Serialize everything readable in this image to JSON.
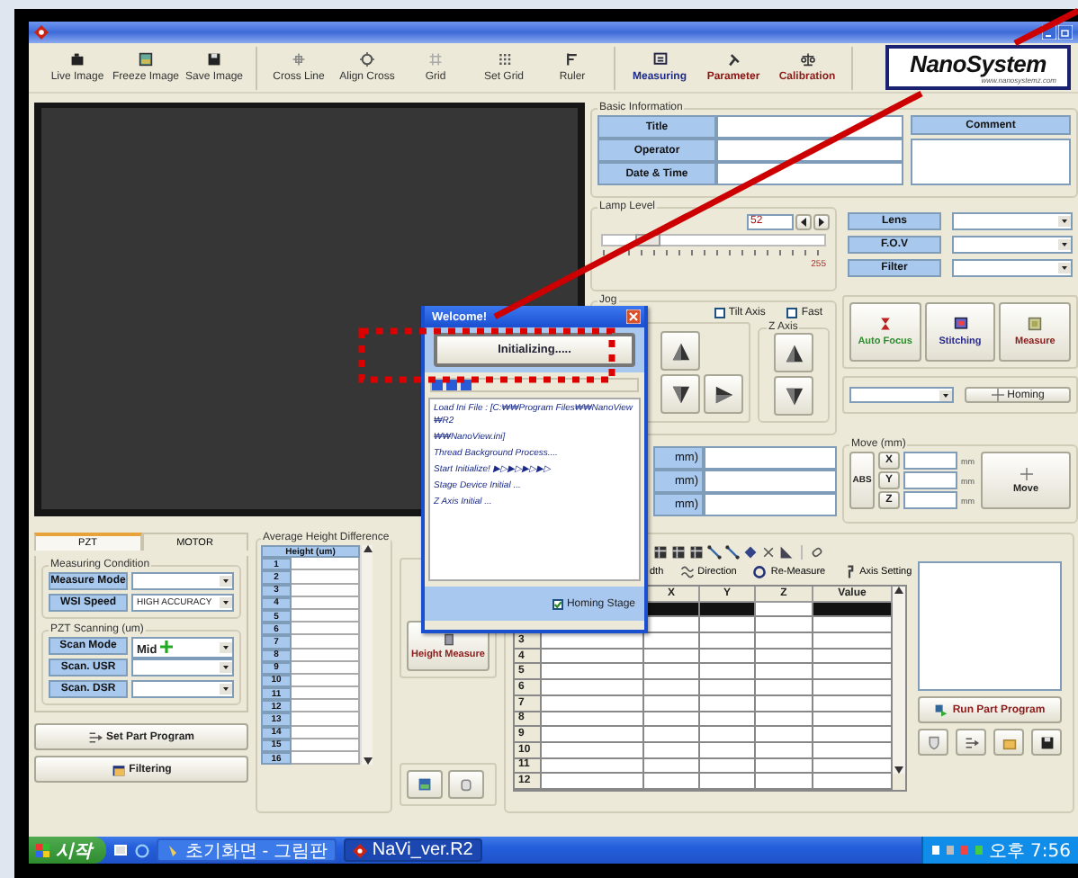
{
  "toolbar": {
    "items": [
      {
        "label": "Live Image",
        "color": "#333333"
      },
      {
        "label": "Freeze Image",
        "color": "#333333"
      },
      {
        "label": "Save Image",
        "color": "#333333"
      },
      {
        "label": "Cross Line",
        "color": "#333333"
      },
      {
        "label": "Align Cross",
        "color": "#333333"
      },
      {
        "label": "Grid",
        "color": "#333333"
      },
      {
        "label": "Set Grid",
        "color": "#333333"
      },
      {
        "label": "Ruler",
        "color": "#333333"
      },
      {
        "label": "Measuring",
        "color": "#1c2a8c"
      },
      {
        "label": "Parameter",
        "color": "#8b1010"
      },
      {
        "label": "Calibration",
        "color": "#8b1a1a"
      }
    ]
  },
  "logo": {
    "text": "NanoSystem",
    "url": "www.nanosystemz.com"
  },
  "basic_information": {
    "title": "Basic Information",
    "fields": [
      {
        "label": "Title"
      },
      {
        "label": "Operator"
      },
      {
        "label": "Date & Time"
      }
    ],
    "comment": "Comment"
  },
  "lamp_level": {
    "title": "Lamp Level",
    "value": "52",
    "level": 0.2,
    "max": "255"
  },
  "optics": [
    {
      "label": "Lens"
    },
    {
      "label": "F.O.V"
    },
    {
      "label": "Filter"
    }
  ],
  "jog": {
    "title": "Jog",
    "options": [
      {
        "label": "Tilt Axis",
        "checked": false
      },
      {
        "label": "Fast",
        "checked": false
      }
    ],
    "z_axis": "Z Axis"
  },
  "positions": [
    {
      "label": "mm)"
    },
    {
      "label": "mm)"
    },
    {
      "label": "mm)"
    }
  ],
  "actions": [
    {
      "label": "Auto Focus",
      "color": "#2e8b2e"
    },
    {
      "label": "Stitching",
      "color": "#2a2a8a"
    },
    {
      "label": "Measure",
      "color": "#8b1a1a"
    }
  ],
  "homing": {
    "button": "Homing"
  },
  "move": {
    "title": "Move (mm)",
    "mode": "ABS",
    "axes": [
      {
        "label": "X",
        "unit": "mm"
      },
      {
        "label": "Y",
        "unit": "mm"
      },
      {
        "label": "Z",
        "unit": "mm"
      }
    ],
    "button": "Move"
  },
  "condition_tabs": [
    {
      "label": "PZT",
      "selected": true
    },
    {
      "label": "MOTOR",
      "selected": false
    }
  ],
  "measuring_condition": {
    "title": "Measuring Condition",
    "rows": [
      {
        "label": "Measure Mode"
      },
      {
        "label": "WSI Speed",
        "value": "HIGH ACCURACY"
      }
    ]
  },
  "pzt_scanning": {
    "title": "PZT Scanning (um)",
    "rows": [
      {
        "label": "Scan Mode",
        "value": "Mid"
      },
      {
        "label": "Scan. USR"
      },
      {
        "label": "Scan. DSR"
      }
    ]
  },
  "program_buttons": [
    {
      "label": "Set Part Program"
    },
    {
      "label": "Filtering"
    }
  ],
  "average_height": {
    "title": "Average Height Difference",
    "column": "Height (um)",
    "rows": [
      "1",
      "2",
      "3",
      "4",
      "5",
      "6",
      "7",
      "8",
      "9",
      "10",
      "11",
      "12",
      "13",
      "14",
      "15",
      "16"
    ]
  },
  "height_measure": {
    "button": "Height Measure"
  },
  "results": {
    "options": [
      {
        "label": "dth"
      },
      {
        "label": "Direction"
      },
      {
        "label": "Re-Measure"
      },
      {
        "label": "Axis Setting"
      }
    ],
    "columns": [
      "X",
      "Y",
      "Z",
      "Value"
    ],
    "active_row": [
      {
        "selected": true
      },
      {
        "selected": true
      },
      {
        "selected": false
      },
      {
        "selected": true
      }
    ],
    "rows": [
      "3",
      "4",
      "5",
      "6",
      "7",
      "8",
      "9",
      "10",
      "11",
      "12"
    ],
    "run_button": "Run Part Program"
  },
  "dialog": {
    "title": "Welcome!",
    "button": "Initializing.....",
    "level": 0.2,
    "log": [
      "Load Ini File : [C:₩₩Program Files₩₩NanoView₩R2",
      "₩₩NanoView.ini]",
      "Thread Background Process....",
      "Start Initialize! ▶▷▶▷▶▷▶▷",
      "Stage Device Initial ...",
      "Z Axis Initial ..."
    ],
    "homing_stage": {
      "label": "Homing Stage",
      "checked": true
    }
  },
  "taskbar": {
    "start": "시작",
    "tasks": [
      {
        "label": "초기화면 - 그림판",
        "selected": false
      },
      {
        "label": "NaVi_ver.R2",
        "selected": true
      }
    ],
    "clock": "오후 7:56"
  }
}
